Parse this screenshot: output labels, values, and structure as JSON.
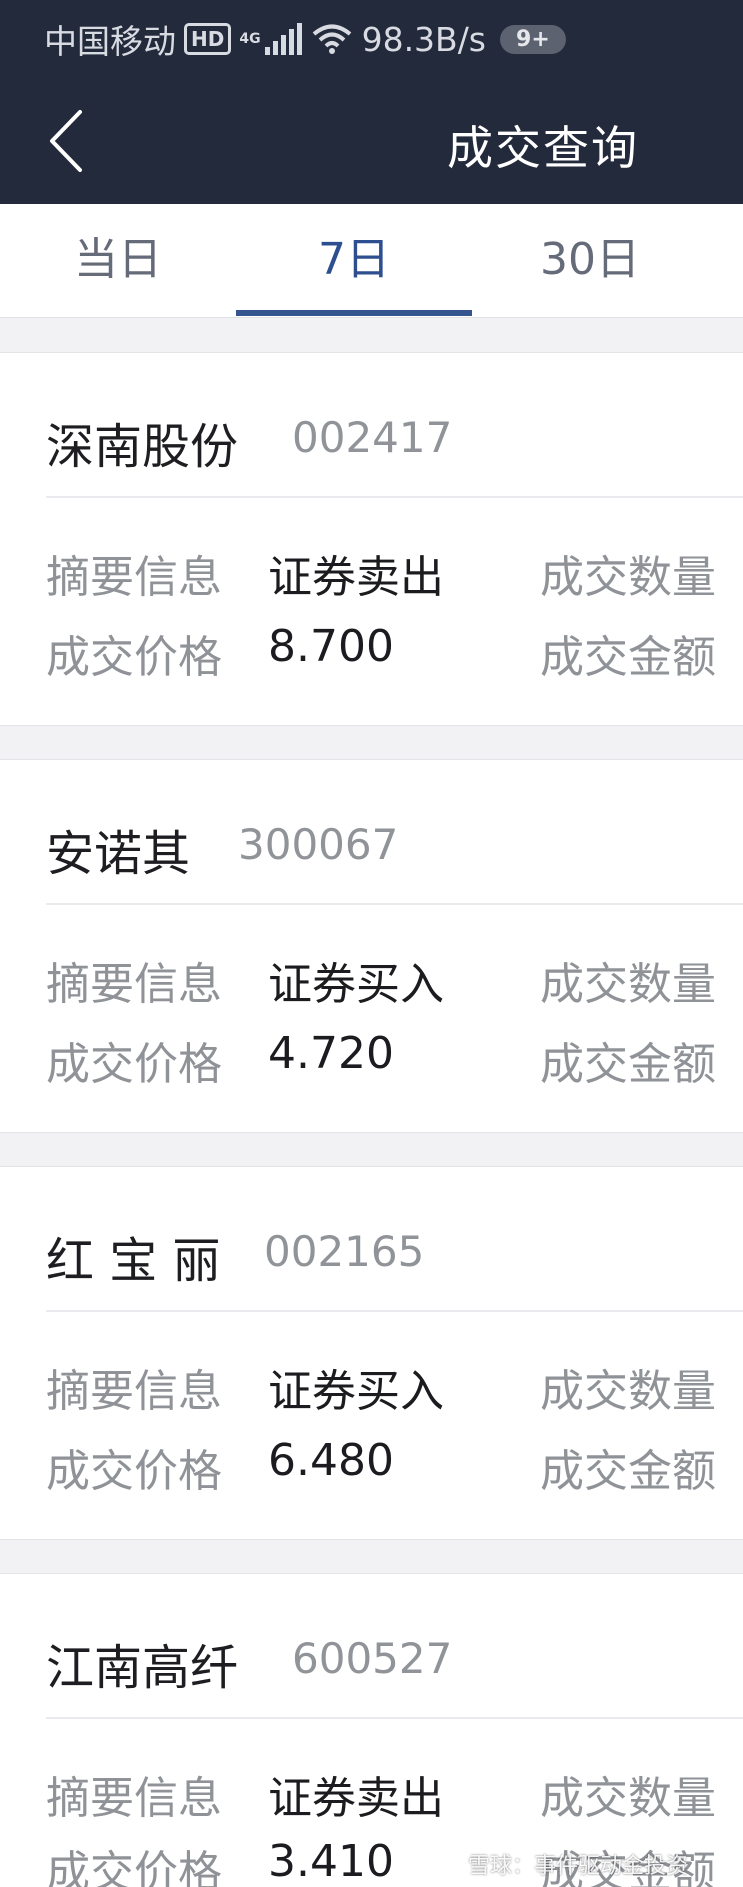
{
  "status_bar": {
    "carrier": "中国移动",
    "hd": "HD",
    "network": "4G",
    "speed": "98.3B/s",
    "badge": "9+"
  },
  "header": {
    "back_icon": "chevron-left-icon",
    "title": "成交查询"
  },
  "tabs": [
    {
      "label": "当日",
      "active": false
    },
    {
      "label": "7日",
      "active": true
    },
    {
      "label": "30日",
      "active": false
    }
  ],
  "accent_color": "#34558f",
  "labels": {
    "summary": "摘要信息",
    "price": "成交价格",
    "quantity": "成交数量",
    "amount": "成交金额"
  },
  "trades": [
    {
      "name": "深南股份",
      "code": "002417",
      "summary": "证券卖出",
      "price": "8.700"
    },
    {
      "name": "安诺其",
      "code": "300067",
      "summary": "证券买入",
      "price": "4.720"
    },
    {
      "name": "红 宝 丽",
      "code": "002165",
      "summary": "证券买入",
      "price": "6.480"
    },
    {
      "name": "江南高纤",
      "code": "600527",
      "summary": "证券卖出",
      "price": "3.410"
    }
  ],
  "watermark": "雪球：事件驱动金投资"
}
